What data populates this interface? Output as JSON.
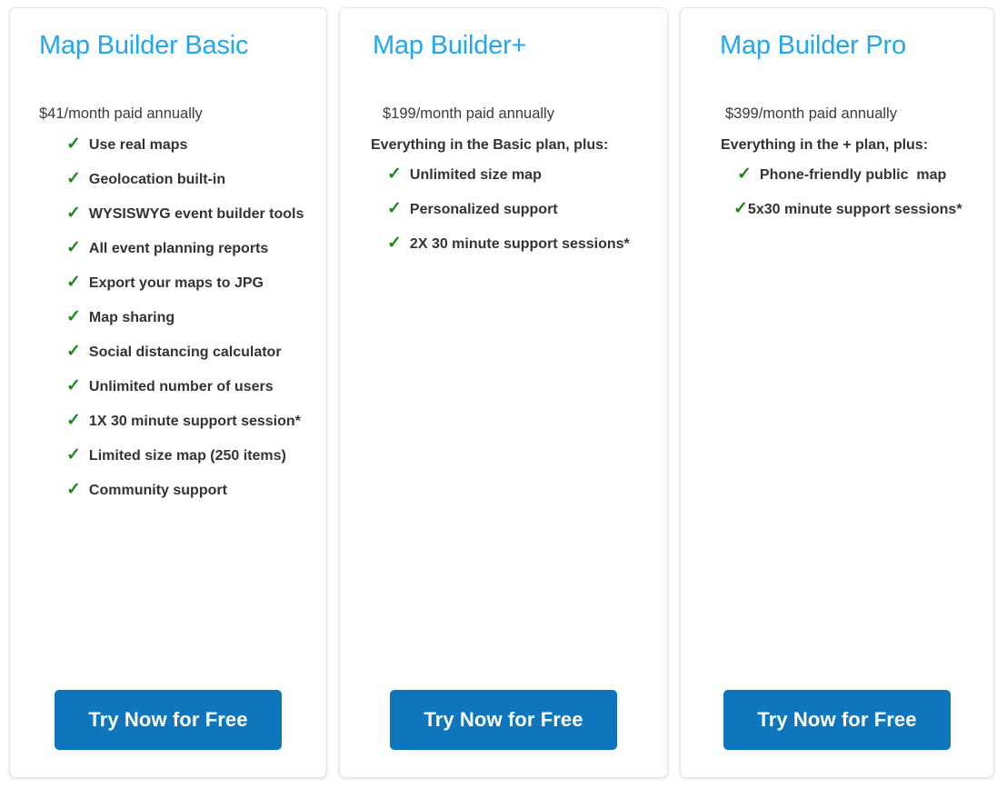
{
  "theme": {
    "title_color": "#1fa7f0",
    "check_color": "#188a18",
    "button_color": "#0f76bd",
    "button_text_color": "#ffffff",
    "text_color": "#333333",
    "card_background": "#ffffff",
    "page_background": "#ffffff"
  },
  "check_glyph": "✓",
  "plans": [
    {
      "id": "basic",
      "title": "Map Builder Basic",
      "price": "$41/month paid annually",
      "subhead": "",
      "features": [
        "Use real maps",
        "Geolocation built-in",
        "WYSISWYG event builder tools",
        "All event planning reports",
        "Export your maps to JPG",
        "Map sharing",
        "Social distancing calculator",
        "Unlimited number of users",
        "1X 30 minute support session*",
        "Limited size map (250 items)",
        "Community support"
      ],
      "cta": "Try Now for Free"
    },
    {
      "id": "plus",
      "title": "Map Builder+",
      "price": "$199/month paid annually",
      "subhead": "Everything in the Basic plan, plus:",
      "features": [
        "Unlimited size map",
        "Personalized support",
        "2X 30 minute support sessions*"
      ],
      "cta": "Try Now for Free"
    },
    {
      "id": "pro",
      "title": "Map Builder Pro",
      "price": "$399/month paid annually",
      "subhead": "Everything in the + plan, plus:",
      "features": [
        "Phone-friendly public  map",
        "5x30 minute support sessions*"
      ],
      "cta": "Try Now for Free"
    }
  ]
}
